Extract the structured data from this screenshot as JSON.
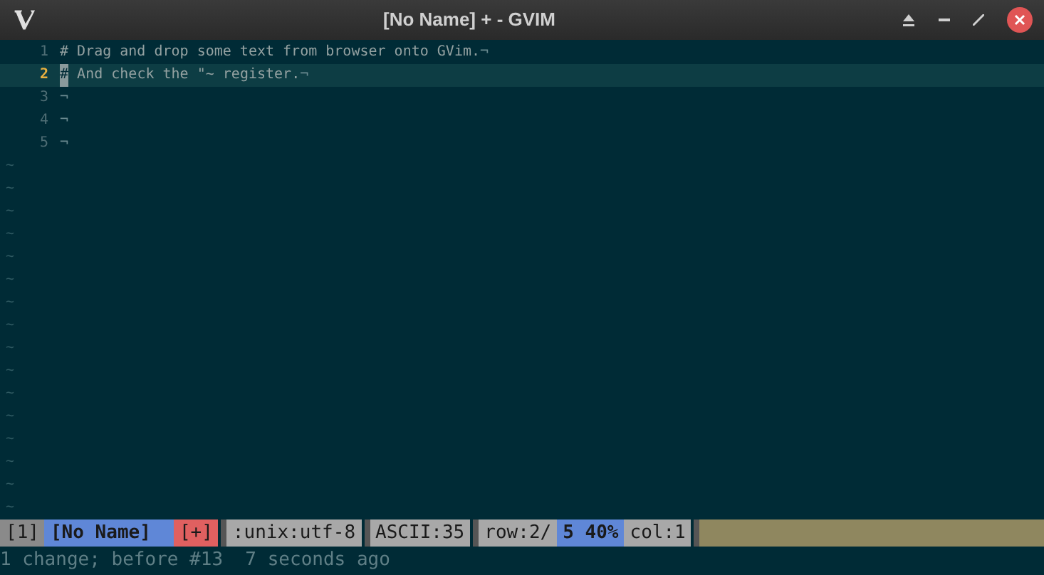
{
  "window": {
    "title": "[No Name] + - GVIM"
  },
  "buffer": {
    "lines": [
      {
        "number": "1",
        "text": "# Drag and drop some text from browser onto GVim.",
        "eol": "¬",
        "current": false,
        "cursor": false
      },
      {
        "number": "2",
        "text": "# And check the \"~ register.",
        "eol": "¬",
        "current": true,
        "cursor": true
      },
      {
        "number": "3",
        "eol": "¬",
        "current": false,
        "cursor": false
      },
      {
        "number": "4",
        "eol": "¬",
        "current": false,
        "cursor": false
      },
      {
        "number": "5",
        "eol": "¬",
        "current": false,
        "cursor": false
      }
    ],
    "filler": [
      "~",
      "~",
      "~",
      "~",
      "~",
      "~",
      "~",
      "~",
      "~",
      "~",
      "~",
      "~",
      "~",
      "~",
      "~",
      "~"
    ]
  },
  "status_line": {
    "segments": [
      {
        "text": "[1]",
        "color": "#8a8a8a",
        "bold": false,
        "gap_before": false
      },
      {
        "text": "[No Name]",
        "color": "#5f87d7",
        "bold": true,
        "gap_before": false
      },
      {
        "kind": "fill",
        "color": "#5f87d7",
        "gap_before": false,
        "grow": false
      },
      {
        "text": "[+]",
        "color": "#e06060",
        "bold": false,
        "gap_before": false
      },
      {
        "text": ":unix:utf-8",
        "color": "#a8a8a8",
        "bold": false,
        "gap_before": true
      },
      {
        "text": "ASCII:35",
        "color": "#a8a8a8",
        "bold": false,
        "gap_before": true
      },
      {
        "text": "row:2/",
        "color": "#a8a8a8",
        "bold": false,
        "gap_before": true
      },
      {
        "text": "5 40%",
        "color": "#5f87d7",
        "bold": true,
        "gap_before": false
      },
      {
        "text": "col:1",
        "color": "#a8a8a8",
        "bold": false,
        "gap_before": false
      },
      {
        "kind": "fill",
        "color": "#8f875f",
        "gap_before": true,
        "grow": true
      }
    ]
  },
  "message": "1 change; before #13  7 seconds ago"
}
